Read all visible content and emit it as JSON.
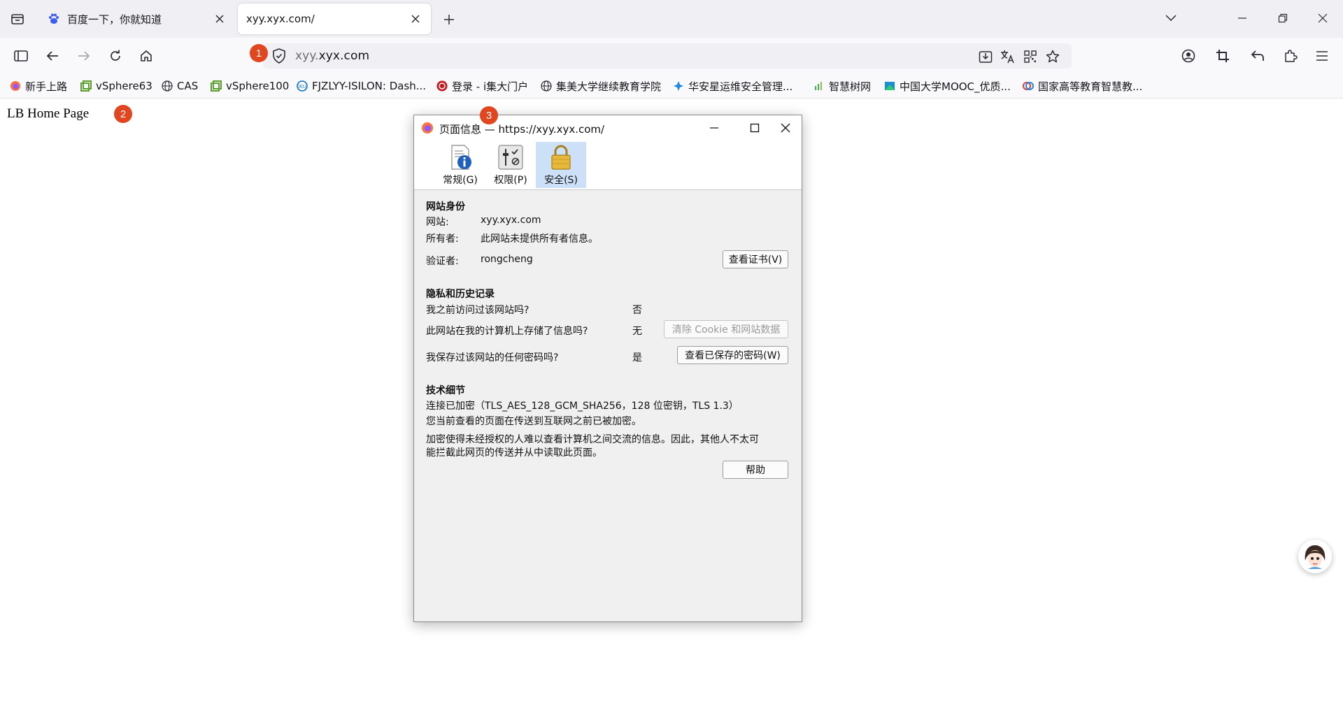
{
  "tabs": [
    {
      "title": "百度一下，你就知道",
      "favicon": "baidu-paw-icon",
      "active": false
    },
    {
      "title": "xyy.xyx.com/",
      "favicon": "none",
      "active": true
    }
  ],
  "urlbar": {
    "url_prefix": "xyy.",
    "url_domain": "xyx.com"
  },
  "bookmarks": [
    {
      "label": "新手上路",
      "icon": "firefox-icon"
    },
    {
      "label": "vSphere63",
      "icon": "vsphere-icon"
    },
    {
      "label": "CAS",
      "icon": "globe-icon"
    },
    {
      "label": "vSphere100",
      "icon": "vsphere-icon"
    },
    {
      "label": "FJZLYY-ISILON: Dash...",
      "icon": "dell-icon"
    },
    {
      "label": "登录 - i集大门户",
      "icon": "jmu-icon"
    },
    {
      "label": "集美大学继续教育学院",
      "icon": "globe-icon"
    },
    {
      "label": "华安星运维安全管理...",
      "icon": "star-logo-icon"
    },
    {
      "label": "智慧树网",
      "icon": "zhihuishu-icon"
    },
    {
      "label": "中国大学MOOC_优质...",
      "icon": "mooc-icon"
    },
    {
      "label": "国家高等教育智慧教...",
      "icon": "smartedu-icon"
    }
  ],
  "page": {
    "heading": "LB Home Page"
  },
  "markers": [
    "1",
    "2",
    "3"
  ],
  "dialog": {
    "title": "页面信息 — https://xyy.xyx.com/",
    "tabs": [
      {
        "label": "常规(G)",
        "icon": "info-icon"
      },
      {
        "label": "权限(P)",
        "icon": "permissions-icon"
      },
      {
        "label": "安全(S)",
        "icon": "lock-icon",
        "selected": true
      }
    ],
    "identity": {
      "heading": "网站身份",
      "website_label": "网站:",
      "website_value": "xyy.xyx.com",
      "owner_label": "所有者:",
      "owner_value": "此网站未提供所有者信息。",
      "verifier_label": "验证者:",
      "verifier_value": "rongcheng",
      "view_cert_button": "查看证书(V)"
    },
    "privacy": {
      "heading": "隐私和历史记录",
      "q1": "我之前访问过该网站吗?",
      "a1": "否",
      "q2": "此网站在我的计算机上存储了信息吗?",
      "a2": "无",
      "clear_button": "清除 Cookie 和网站数据",
      "q3": "我保存过该网站的任何密码吗?",
      "a3": "是",
      "view_passwords_button": "查看已保存的密码(W)"
    },
    "technical": {
      "heading": "技术细节",
      "line1": "连接已加密（TLS_AES_128_GCM_SHA256，128 位密钥，TLS 1.3）",
      "line2": "您当前查看的页面在传送到互联网之前已被加密。",
      "line3a": "加密使得未经授权的人难以查看计算机之间交流的信息。因此，其他人不太可",
      "line3b": "能拦截此网页的传送并从中读取此页面。",
      "help_button": "帮助"
    }
  },
  "colors": {
    "marker": "#e2461f",
    "selected_tab": "#cce0f7",
    "tabstrip": "#f0f0f4"
  }
}
